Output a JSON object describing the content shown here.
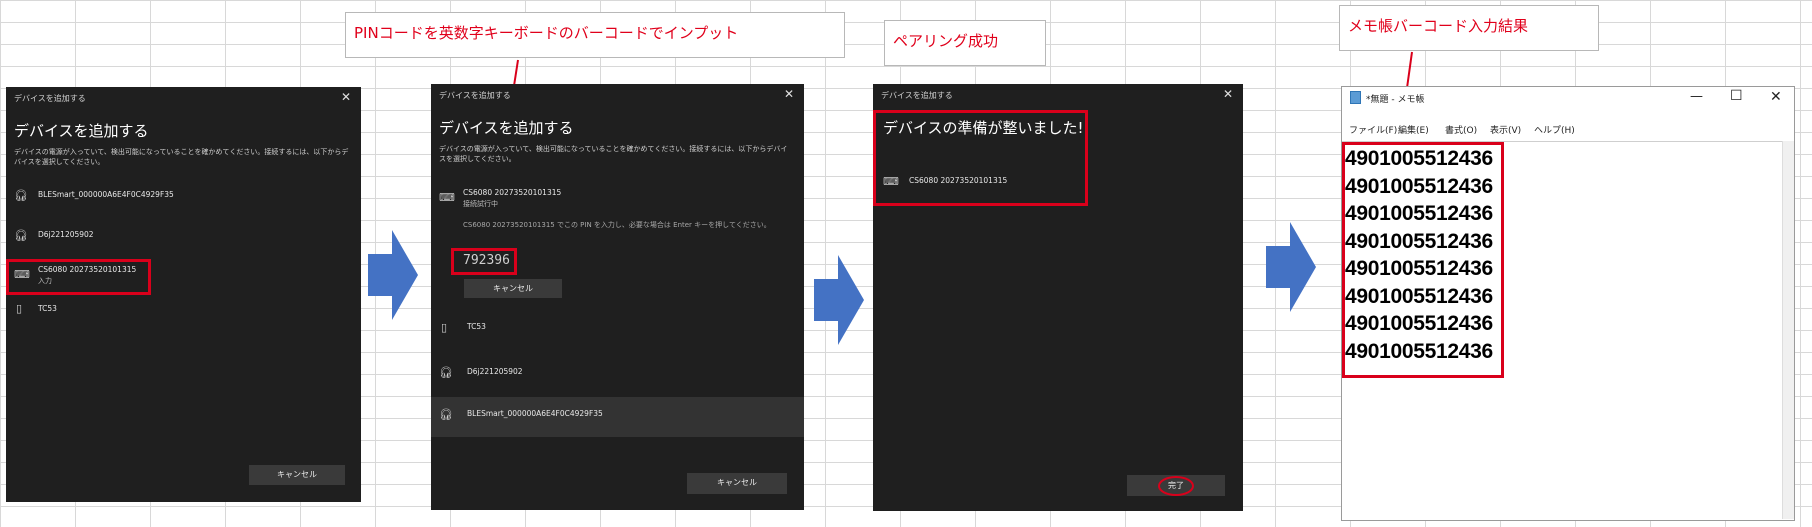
{
  "callouts": {
    "pin_input": "PINコードを英数字キーボードのバーコードでインプット",
    "pairing_success": "ペアリング成功",
    "notepad_result": "メモ帳バーコード入力結果"
  },
  "dialog1": {
    "title": "デバイスを追加する",
    "heading": "デバイスを追加する",
    "description": "デバイスの電源が入っていて、検出可能になっていることを確かめてください。接続するには、以下からデバイスを選択してください。",
    "devices": [
      {
        "name": "BLESmart_000000A6E4F0C4929F35",
        "sub": "",
        "icon": "headset-icon"
      },
      {
        "name": "D6j221205902",
        "sub": "",
        "icon": "headset-icon"
      },
      {
        "name": "CS6080 20273520101315",
        "sub": "入力",
        "icon": "keyboard-icon"
      },
      {
        "name": "TC53",
        "sub": "",
        "icon": "phone-icon"
      }
    ],
    "cancel": "キャンセル"
  },
  "dialog2": {
    "title": "デバイスを追加する",
    "heading": "デバイスを追加する",
    "description": "デバイスの電源が入っていて、検出可能になっていることを確かめてください。接続するには、以下からデバイスを選択してください。",
    "connecting_device": "CS6080 20273520101315",
    "connecting_status": "接続試行中",
    "pin_instruction": "CS6080 20273520101315 でこの PIN を入力し、必要な場合は Enter キーを押してください。",
    "pin": "792396",
    "pin_cancel": "キャンセル",
    "devices": [
      {
        "name": "TC53",
        "icon": "phone-icon"
      },
      {
        "name": "D6j221205902",
        "icon": "headset-icon"
      },
      {
        "name": "BLESmart_000000A6E4F0C4929F35",
        "icon": "headset-icon"
      }
    ],
    "cancel": "キャンセル"
  },
  "dialog3": {
    "title": "デバイスを追加する",
    "heading": "デバイスの準備が整いました!",
    "device": "CS6080 20273520101315",
    "done": "完了"
  },
  "notepad": {
    "title": "*無題 - メモ帳",
    "controls": {
      "minimize": "—",
      "maximize": "☐",
      "close": "✕"
    },
    "menu": [
      "ファイル(F)",
      "編集(E)",
      "書式(O)",
      "表示(V)",
      "ヘルプ(H)"
    ],
    "lines": [
      "4901005512436",
      "4901005512436",
      "4901005512436",
      "4901005512436",
      "4901005512436",
      "4901005512436",
      "4901005512436",
      "4901005512436"
    ]
  },
  "colors": {
    "dialog_bg": "#1f1f1f",
    "highlight_red": "#d9001b",
    "arrow_blue": "#4472c4",
    "callout_text": "#e0001b"
  }
}
